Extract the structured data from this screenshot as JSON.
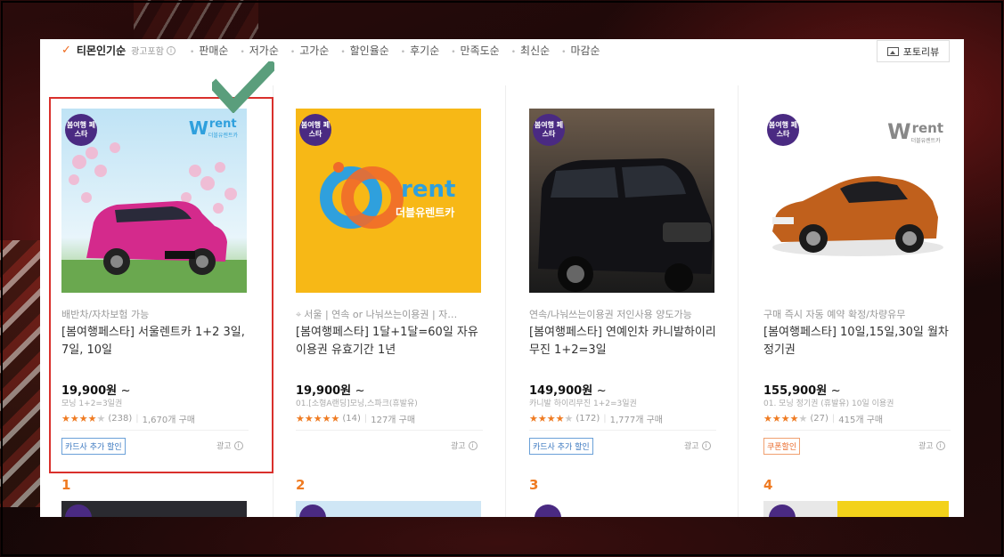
{
  "sort_bar": {
    "active_label": "티몬인기순",
    "ad_note": "광고포함",
    "items": [
      "판매순",
      "저가순",
      "고가순",
      "할인율순",
      "후기순",
      "만족도순",
      "최신순",
      "마감순"
    ],
    "photo_review_label": "포토리뷰"
  },
  "products": [
    {
      "badge": "봄여행 페스타",
      "logo_brand": "rent",
      "logo_sub": "더블유렌트카",
      "tagline": "배반차/자차보험 가능",
      "title": "[봄여행페스타] 서울렌트카 1+2 3일, 7일, 10일",
      "price": "19,900원",
      "option": "모닝 1+2=3일권",
      "rating_count": "(238)",
      "sold": "1,670개 구매",
      "benefit": "카드사 추가 할인",
      "ad": "광고"
    },
    {
      "badge": "봄여행 페스타",
      "logo_brand": "rent",
      "logo_sub": "더블유렌트카",
      "tagline": "서울 | 연속 or 나눠쓰는이용권 | 자…",
      "title": "[봄여행페스타] 1달+1달=60일 자유이용권 유효기간 1년",
      "price": "19,900원",
      "option": "01.[소형A랜딩]모닝,스파크(휴발유)",
      "rating_count": "(14)",
      "sold": "127개 구매",
      "benefit": "",
      "ad": "광고"
    },
    {
      "badge": "봄여행 페스타",
      "tagline": "연속/나눠쓰는이용권 저인사용 양도가능",
      "title": "[봄여행페스타] 연예인차 카니발하이리무진 1+2=3일",
      "price": "149,900원",
      "option": "카니발 하이리무진 1+2=3일권",
      "rating_count": "(172)",
      "sold": "1,777개 구매",
      "benefit": "카드사 추가 할인",
      "ad": "광고"
    },
    {
      "badge": "봄여행 페스타",
      "logo_brand": "rent",
      "logo_sub": "더블유렌트카",
      "tagline": "구매 즉시 자동 예약 확정/차량유무",
      "title": "[봄여행페스타] 10일,15일,30일 월차 정기권",
      "price": "155,900원",
      "option": "01. 모닝 정기권 (휴발유) 10일 이용권",
      "rating_count": "(27)",
      "sold": "415개 구매",
      "benefit": "쿠폰할인",
      "ad": "광고"
    }
  ],
  "ranks": [
    "1",
    "2",
    "3",
    "4"
  ],
  "price_suffix": "~",
  "brand_letter": "W",
  "colors": {
    "accent_orange": "#ef7b22",
    "highlight_red": "#d9302c",
    "check_green": "#5a9e7c",
    "badge_purple": "#4a2a82",
    "logo_blue": "#2fa0dd"
  }
}
